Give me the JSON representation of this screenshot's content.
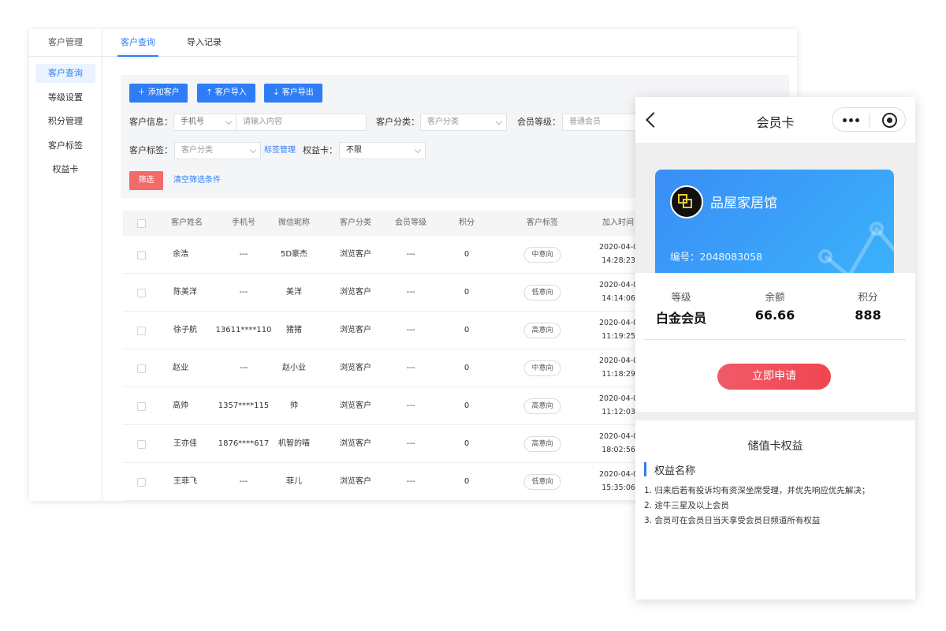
{
  "sidebar": {
    "title": "客户管理",
    "items": [
      {
        "label": "客户查询",
        "active": true
      },
      {
        "label": "等级设置"
      },
      {
        "label": "积分管理"
      },
      {
        "label": "客户标签"
      },
      {
        "label": "权益卡"
      }
    ]
  },
  "tabs": [
    {
      "label": "客户查询",
      "active": true
    },
    {
      "label": "导入记录"
    }
  ],
  "toolbar": {
    "add_label": "添加客户",
    "import_label": "客户导入",
    "export_label": "客户导出"
  },
  "filters": {
    "info_label": "客户信息：",
    "info_type": "手机号",
    "info_placeholder": "请输入内容",
    "category_label": "客户分类：",
    "category_placeholder": "客户分类",
    "level_label": "会员等级：",
    "level_placeholder": "普通会员",
    "tag_label": "客户标签：",
    "tag_placeholder": "客户分类",
    "tag_manage_link": "标签管理",
    "card_label": "权益卡：",
    "card_value": "不限",
    "filter_button": "筛选",
    "clear_link": "清空筛选条件"
  },
  "table": {
    "headers": [
      "客户姓名",
      "手机号",
      "微信昵称",
      "客户分类",
      "会员等级",
      "积分",
      "客户标签",
      "加入时间"
    ],
    "rows": [
      {
        "name": "余浩",
        "phone": "---",
        "wechat": "5D豪杰",
        "category": "浏览客户",
        "level": "---",
        "points": "0",
        "tag": "中意向",
        "date": "2020-04-0",
        "time": "14:28:23"
      },
      {
        "name": "陈美洋",
        "phone": "---",
        "wechat": "美洋",
        "category": "浏览客户",
        "level": "---",
        "points": "0",
        "tag": "低意向",
        "date": "2020-04-0",
        "time": "14:14:06"
      },
      {
        "name": "徐子航",
        "phone": "13611****110",
        "wechat": "猪猪",
        "category": "浏览客户",
        "level": "---",
        "points": "0",
        "tag": "高意向",
        "date": "2020-04-0",
        "time": "11:19:25"
      },
      {
        "name": "赵业",
        "phone": "---",
        "wechat": "赵小业",
        "category": "浏览客户",
        "level": "---",
        "points": "0",
        "tag": "中意向",
        "date": "2020-04-0",
        "time": "11:18:29"
      },
      {
        "name": "高帅",
        "phone": "1357****115",
        "wechat": "帅",
        "category": "浏览客户",
        "level": "---",
        "points": "0",
        "tag": "高意向",
        "date": "2020-04-0",
        "time": "11:12:03"
      },
      {
        "name": "王亦佳",
        "phone": "1876****617",
        "wechat": "机智的喵",
        "category": "浏览客户",
        "level": "---",
        "points": "0",
        "tag": "高意向",
        "date": "2020-04-0",
        "time": "18:02:56"
      },
      {
        "name": "王菲飞",
        "phone": "---",
        "wechat": "菲儿",
        "category": "浏览客户",
        "level": "---",
        "points": "0",
        "tag": "低意向",
        "date": "2020-04-0",
        "time": "15:35:06"
      }
    ]
  },
  "phone": {
    "title": "会员卡",
    "card": {
      "brand": "品屋家居馆",
      "number": "编号：2048083058"
    },
    "stats": [
      {
        "label": "等级",
        "value": "白金会员"
      },
      {
        "label": "余额",
        "value": "66.66"
      },
      {
        "label": "积分",
        "value": "888"
      }
    ],
    "apply_label": "立即申请",
    "benefits_title": "储值卡权益",
    "benefit_name": "权益名称",
    "benefit_items": [
      "1. 归来后若有投诉均有资深坐席受理，并优先响应优先解决；",
      "2. 途牛三星及以上会员",
      "3. 会员可在会员日当天享受会员日频道所有权益"
    ]
  }
}
